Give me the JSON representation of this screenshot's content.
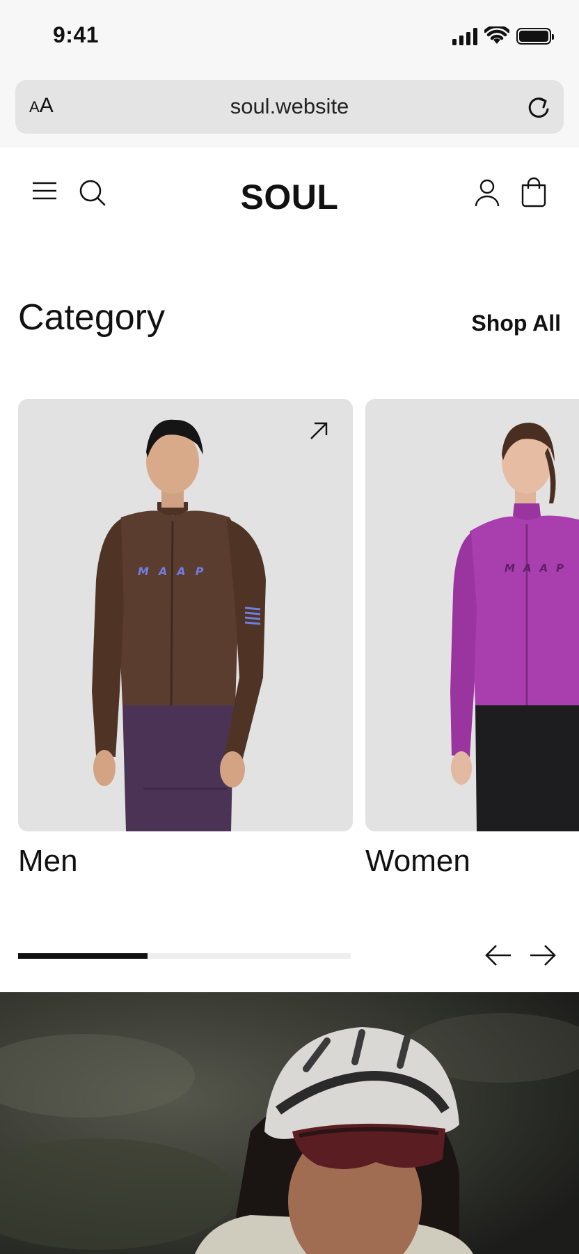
{
  "status_bar": {
    "time": "9:41"
  },
  "browser": {
    "url": "soul.website",
    "text_size_label_small": "A",
    "text_size_label_large": "A"
  },
  "header": {
    "logo": "SOUL"
  },
  "category": {
    "title": "Category",
    "shop_all": "Shop All",
    "cards": [
      {
        "label": "Men",
        "shirt_color": "#5a3d2e",
        "shorts_color": "#4b3356",
        "chest_text": "MAAP"
      },
      {
        "label": "Women",
        "shirt_color": "#a93fae",
        "shorts_color": "#1d1d1f",
        "chest_text": "MAAP"
      }
    ],
    "carousel_progress": 0.39
  },
  "colors": {
    "card_bg": "#e2e2e3",
    "accent": "#111111"
  }
}
